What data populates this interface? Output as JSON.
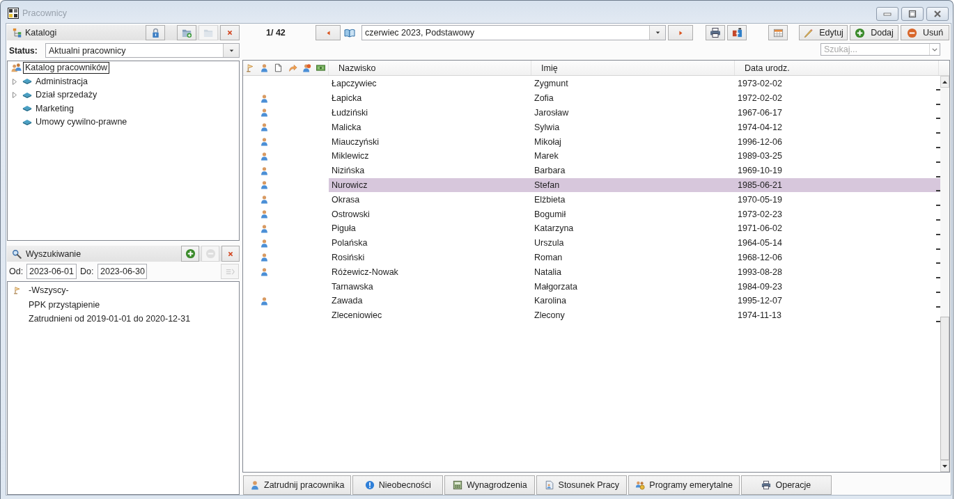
{
  "window": {
    "title": "Pracownicy"
  },
  "catalogs": {
    "title": "Katalogi",
    "buttons": [
      {
        "kind": "lock",
        "disabled": false
      },
      {
        "kind": "folder-add",
        "disabled": false
      },
      {
        "kind": "folder",
        "disabled": true
      },
      {
        "kind": "close",
        "disabled": false
      }
    ],
    "status": {
      "label": "Status:",
      "value": "Aktualni pracownicy"
    },
    "tree": {
      "label": "Katalog pracowników",
      "selected": true,
      "children": [
        {
          "label": "Administracja",
          "expandable": true,
          "selected": false
        },
        {
          "label": "Dział sprzedaży",
          "expandable": true,
          "selected": false
        },
        {
          "label": "Marketing",
          "expandable": false,
          "selected": false
        },
        {
          "label": "Umowy cywilno-prawne",
          "expandable": false,
          "selected": false
        }
      ]
    }
  },
  "search": {
    "title": "Wyszukiwanie",
    "buttons": [
      {
        "kind": "add",
        "disabled": false
      },
      {
        "kind": "remove",
        "disabled": true
      },
      {
        "kind": "close",
        "disabled": false
      }
    ],
    "date_from": {
      "label": "Od:",
      "value": "2023-06-01"
    },
    "date_to": {
      "label": "Do:",
      "value": "2023-06-30"
    },
    "apply_button": {
      "kind": "apply",
      "disabled": true
    },
    "filters": [
      {
        "label": "-Wszyscy-",
        "active": true
      },
      {
        "label": "PPK przystąpienie",
        "active": false
      },
      {
        "label": "Zatrudnieni od 2019-01-01 do 2020-12-31",
        "active": false
      }
    ]
  },
  "toolbar": {
    "counter": "1/ 42",
    "period": {
      "value": "czerwiec 2023, Podstawowy"
    },
    "actions": [
      {
        "kind": "edit",
        "label": "Edytuj"
      },
      {
        "kind": "add",
        "label": "Dodaj"
      },
      {
        "kind": "delete",
        "label": "Usuń"
      }
    ],
    "search": {
      "placeholder": "Szukaj..."
    }
  },
  "table": {
    "columns": [
      "Nazwisko",
      "Imię",
      "Data urodz."
    ],
    "rows": [
      {
        "surname": "Łapczywiec",
        "first_name": "Zygmunt",
        "birth_date": "1973-02-02",
        "employee": false,
        "selected": false
      },
      {
        "surname": "Łapicka",
        "first_name": "Zofia",
        "birth_date": "1972-02-02",
        "employee": true,
        "selected": false
      },
      {
        "surname": "Łudziński",
        "first_name": "Jarosław",
        "birth_date": "1967-06-17",
        "employee": true,
        "selected": false
      },
      {
        "surname": "Malicka",
        "first_name": "Sylwia",
        "birth_date": "1974-04-12",
        "employee": true,
        "selected": false
      },
      {
        "surname": "Miauczyński",
        "first_name": "Mikołaj",
        "birth_date": "1996-12-06",
        "employee": true,
        "selected": false
      },
      {
        "surname": "Miklewicz",
        "first_name": "Marek",
        "birth_date": "1989-03-25",
        "employee": true,
        "selected": false
      },
      {
        "surname": "Nizińska",
        "first_name": "Barbara",
        "birth_date": "1969-10-19",
        "employee": true,
        "selected": false
      },
      {
        "surname": "Nurowicz",
        "first_name": "Stefan",
        "birth_date": "1985-06-21",
        "employee": true,
        "selected": true
      },
      {
        "surname": "Okrasa",
        "first_name": "Elżbieta",
        "birth_date": "1970-05-19",
        "employee": true,
        "selected": false
      },
      {
        "surname": "Ostrowski",
        "first_name": "Bogumił",
        "birth_date": "1973-02-23",
        "employee": true,
        "selected": false
      },
      {
        "surname": "Piguła",
        "first_name": "Katarzyna",
        "birth_date": "1971-06-02",
        "employee": true,
        "selected": false
      },
      {
        "surname": "Polańska",
        "first_name": "Urszula",
        "birth_date": "1964-05-14",
        "employee": true,
        "selected": false
      },
      {
        "surname": "Rosiński",
        "first_name": "Roman",
        "birth_date": "1968-12-06",
        "employee": true,
        "selected": false
      },
      {
        "surname": "Różewicz-Nowak",
        "first_name": "Natalia",
        "birth_date": "1993-08-28",
        "employee": true,
        "selected": false
      },
      {
        "surname": "Tarnawska",
        "first_name": "Małgorzata",
        "birth_date": "1984-09-23",
        "employee": false,
        "selected": false
      },
      {
        "surname": "Zawada",
        "first_name": "Karolina",
        "birth_date": "1995-12-07",
        "employee": true,
        "selected": false
      },
      {
        "surname": "Zleceniowiec",
        "first_name": "Zlecony",
        "birth_date": "1974-11-13",
        "employee": false,
        "selected": false
      }
    ]
  },
  "bottom_tabs": [
    {
      "kind": "hire",
      "label": "Zatrudnij pracownika"
    },
    {
      "kind": "absence",
      "label": "Nieobecności"
    },
    {
      "kind": "salary",
      "label": "Wynagrodzenia"
    },
    {
      "kind": "contract",
      "label": "Stosunek Pracy"
    },
    {
      "kind": "pension",
      "label": "Programy emerytalne"
    },
    {
      "kind": "operations",
      "label": "Operacje"
    }
  ]
}
